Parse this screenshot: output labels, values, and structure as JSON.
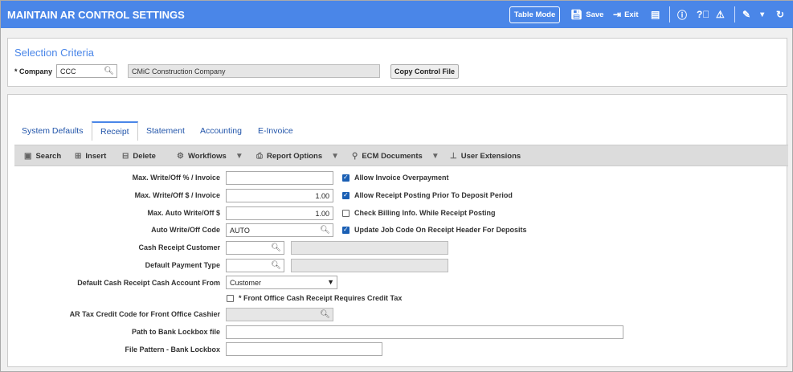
{
  "header": {
    "title": "MAINTAIN AR CONTROL SETTINGS",
    "table_mode": "Table Mode",
    "save": "Save",
    "exit": "Exit"
  },
  "selection": {
    "heading": "Selection Criteria",
    "company_label": "* Company",
    "company_value": "CCC",
    "company_name": "CMiC Construction Company",
    "copy_button": "Copy Control File"
  },
  "tabs": [
    {
      "label": "System Defaults"
    },
    {
      "label": "Receipt"
    },
    {
      "label": "Statement"
    },
    {
      "label": "Accounting"
    },
    {
      "label": "E-Invoice"
    }
  ],
  "toolbar": {
    "search": "Search",
    "insert": "Insert",
    "delete": "Delete",
    "workflows": "Workflows",
    "report_options": "Report Options",
    "ecm_documents": "ECM Documents",
    "user_extensions": "User Extensions"
  },
  "form": {
    "max_writeoff_pct": {
      "label": "Max. Write/Off % / Invoice",
      "value": ""
    },
    "max_writeoff_amt": {
      "label": "Max. Write/Off $ / Invoice",
      "value": "1.00"
    },
    "max_auto_writeoff": {
      "label": "Max. Auto Write/Off $",
      "value": "1.00"
    },
    "auto_writeoff_code": {
      "label": "Auto Write/Off Code",
      "value": "AUTO"
    },
    "cash_receipt_customer": {
      "label": "Cash Receipt Customer",
      "value": ""
    },
    "default_payment_type": {
      "label": "Default Payment Type",
      "value": ""
    },
    "default_cash_account_from": {
      "label": "Default Cash Receipt Cash Account From",
      "value": "Customer"
    },
    "front_office_credit_tax": {
      "label": "* Front Office Cash Receipt Requires Credit Tax",
      "checked": false
    },
    "ar_tax_credit_code": {
      "label": "AR Tax Credit Code for Front Office Cashier",
      "value": ""
    },
    "path_bank_lockbox": {
      "label": "Path to Bank Lockbox file",
      "value": ""
    },
    "file_pattern_lockbox": {
      "label": "File Pattern - Bank Lockbox",
      "value": ""
    },
    "allow_invoice_overpayment": {
      "label": "Allow Invoice Overpayment",
      "checked": true
    },
    "allow_receipt_posting_prior": {
      "label": "Allow Receipt Posting Prior To Deposit Period",
      "checked": true
    },
    "check_billing_info": {
      "label": "Check Billing Info. While Receipt Posting",
      "checked": false
    },
    "update_job_code": {
      "label": "Update Job Code On Receipt Header For Deposits",
      "checked": true
    }
  }
}
